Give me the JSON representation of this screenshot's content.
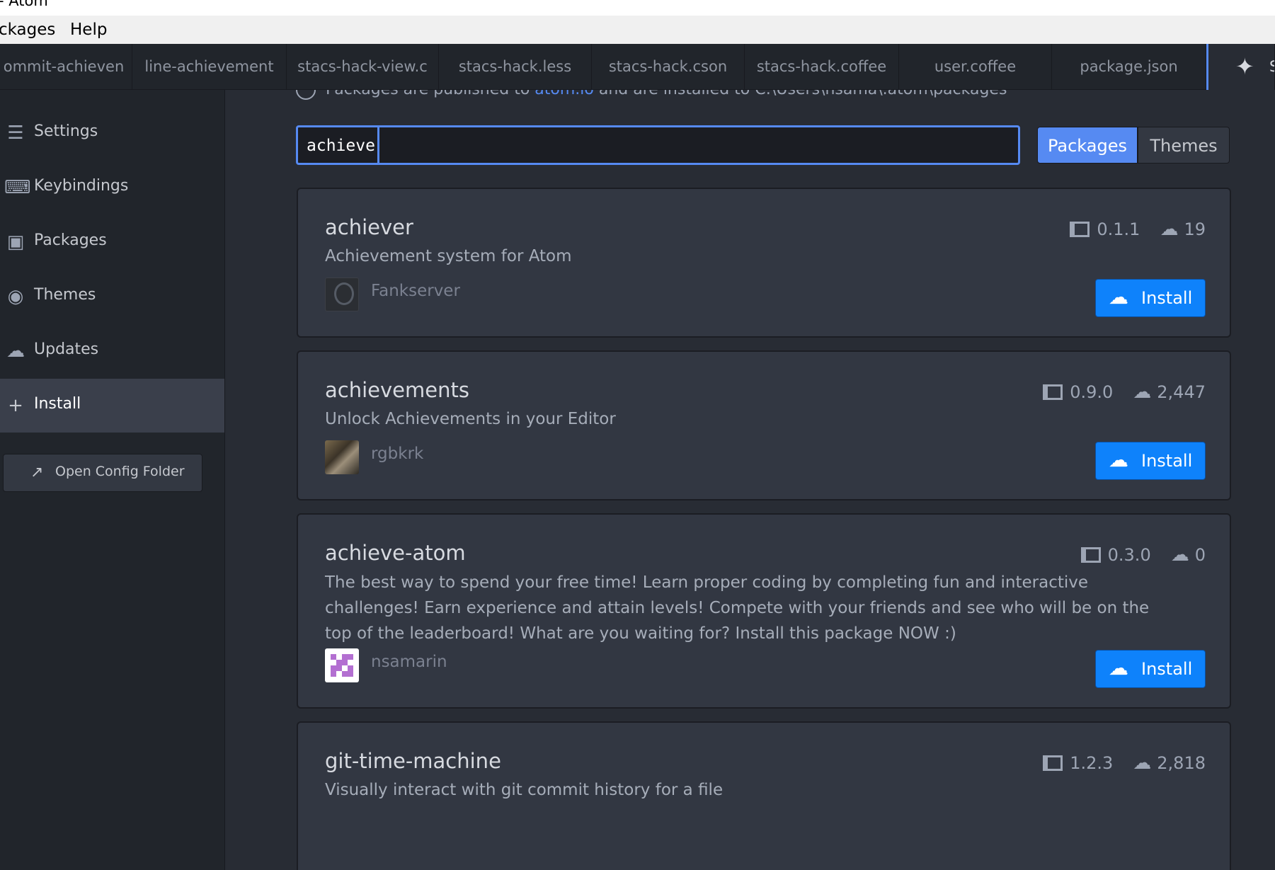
{
  "window": {
    "title": "- Atom"
  },
  "menu": [
    "ckages",
    "Help"
  ],
  "tabs": [
    "ommit-achieven",
    "line-achievement",
    "stacs-hack-view.c",
    "stacs-hack.less",
    "stacs-hack.cson",
    "stacs-hack.coffee",
    "user.coffee",
    "package.json"
  ],
  "active_tab": {
    "label": "S",
    "icon": "tools-icon"
  },
  "sidebar": {
    "items": [
      {
        "label": "Settings",
        "icon": "settings-sliders-icon"
      },
      {
        "label": "Keybindings",
        "icon": "keyboard-icon"
      },
      {
        "label": "Packages",
        "icon": "package-icon"
      },
      {
        "label": "Themes",
        "icon": "paint-bucket-icon"
      },
      {
        "label": "Updates",
        "icon": "cloud-download-icon"
      },
      {
        "label": "Install",
        "icon": "plus-icon"
      }
    ],
    "active": "Install",
    "open_config_label": "Open Config Folder"
  },
  "notice": {
    "pre": "Packages are published to ",
    "link": "atom.io",
    "post": " and are installed to C:\\Users\\nsama\\.atom\\packages"
  },
  "search": {
    "value": "achieve"
  },
  "filter": {
    "packages": "Packages",
    "themes": "Themes",
    "selected": "Packages"
  },
  "packages": [
    {
      "name": "achiever",
      "description": "Achievement system for Atom",
      "author": "Fankserver",
      "version": "0.1.1",
      "downloads": "19",
      "install_label": "Install"
    },
    {
      "name": "achievements",
      "description": "Unlock Achievements in your Editor",
      "author": "rgbkrk",
      "version": "0.9.0",
      "downloads": "2,447",
      "install_label": "Install"
    },
    {
      "name": "achieve-atom",
      "description": "The best way to spend your free time! Learn proper coding by completing fun and interactive challenges! Earn experience and attain levels! Compete with your friends and see who will be on the top of the leaderboard! What are you waiting for? Install this package NOW :)",
      "author": "nsamarin",
      "version": "0.3.0",
      "downloads": "0",
      "install_label": "Install"
    },
    {
      "name": "git-time-machine",
      "description": "Visually interact with git commit history for a file",
      "author": "",
      "version": "1.2.3",
      "downloads": "2,818",
      "install_label": "Install"
    }
  ],
  "colors": {
    "accent": "#568af2",
    "install_button": "#0e82fb",
    "panel": "#323742",
    "sidebar": "#21252b"
  }
}
